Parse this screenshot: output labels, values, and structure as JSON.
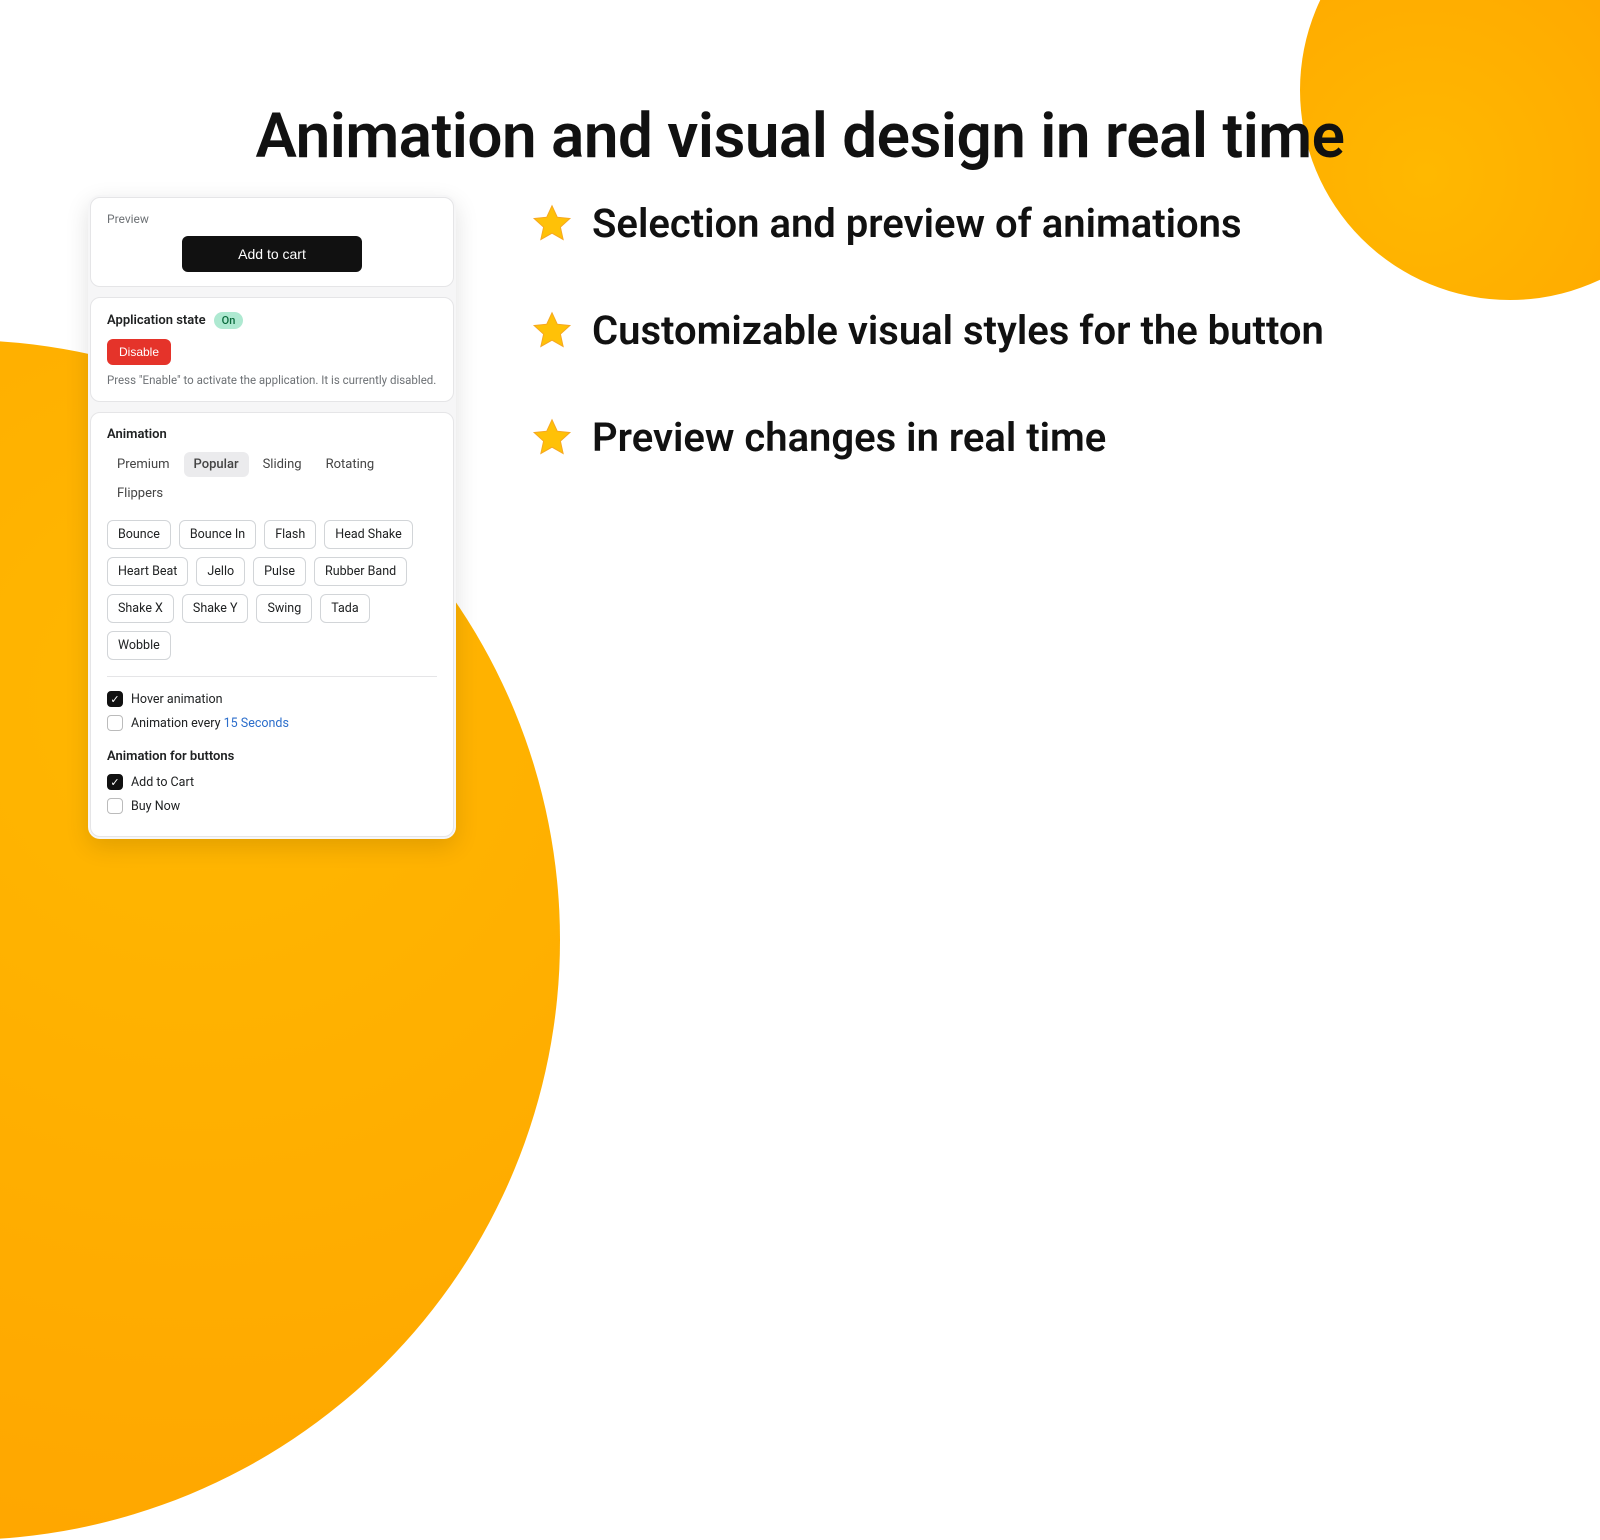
{
  "headline": "Animation and visual design in real time",
  "bullets": [
    "Selection and preview of animations",
    "Customizable visual styles for the button",
    "Preview changes in real time"
  ],
  "preview": {
    "label": "Preview",
    "button_label": "Add to cart"
  },
  "app_state": {
    "title": "Application state",
    "status": "On",
    "button_label": "Disable",
    "description": "Press \"Enable\" to activate the application. It is currently disabled."
  },
  "animation": {
    "title": "Animation",
    "tabs": [
      "Premium",
      "Popular",
      "Sliding",
      "Rotating",
      "Flippers"
    ],
    "active_tab": "Popular",
    "chips": [
      "Bounce",
      "Bounce In",
      "Flash",
      "Head Shake",
      "Heart Beat",
      "Jello",
      "Pulse",
      "Rubber Band",
      "Shake X",
      "Shake Y",
      "Swing",
      "Tada",
      "Wobble"
    ],
    "hover_label": "Hover animation",
    "every_prefix": "Animation every ",
    "every_value": "15 Seconds"
  },
  "anim_for_buttons": {
    "title": "Animation for buttons",
    "options": [
      {
        "label": "Add to Cart",
        "checked": true
      },
      {
        "label": "Buy Now",
        "checked": false
      }
    ]
  }
}
